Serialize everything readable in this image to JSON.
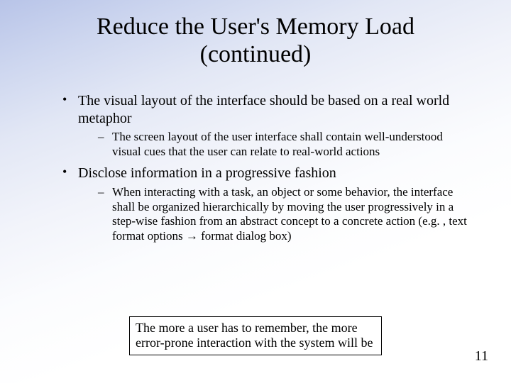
{
  "title": "Reduce the User's Memory Load (continued)",
  "bullets": [
    {
      "text": "The visual layout of the interface should be based on a real world metaphor",
      "sub": [
        "The screen layout of the user interface shall contain well-understood visual cues that the user can relate to real-world actions"
      ]
    },
    {
      "text": "Disclose information in a progressive fashion",
      "sub": [
        "When interacting with a task, an object or some behavior, the interface shall be organized hierarchically by moving the user progressively in a step-wise fashion from an abstract concept to a concrete action (e.g. , text format options → format dialog box)"
      ]
    }
  ],
  "callout": "The more a user has to remember, the more error-prone interaction with the system will be",
  "page_number": "11"
}
